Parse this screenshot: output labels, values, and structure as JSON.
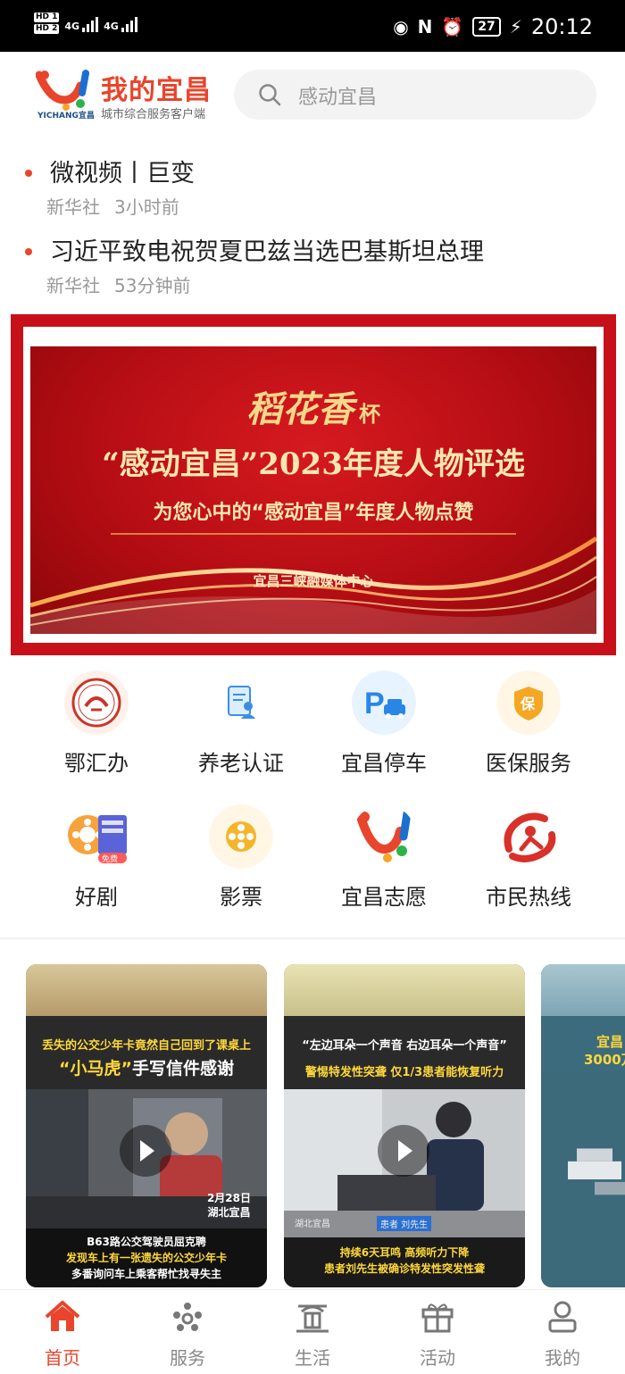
{
  "status_bar": {
    "sim1": "HD 1",
    "sim2": "HD 2",
    "net1": "4G",
    "net2": "4G",
    "battery": "27",
    "time": "20:12"
  },
  "header": {
    "app_title": "我的宜昌",
    "app_subtitle": "城市综合服务客户端",
    "logo_en": "YICHANG宜昌",
    "search_placeholder": "感动宜昌"
  },
  "news": [
    {
      "title": "微视频丨巨变",
      "source": "新华社",
      "time": "3小时前"
    },
    {
      "title": "习近平致电祝贺夏巴兹当选巴基斯坦总理",
      "source": "新华社",
      "time": "53分钟前"
    }
  ],
  "banner": {
    "brand": "稻花香",
    "brand_suffix": "杯",
    "title": "“感动宜昌”2023年度人物评选",
    "subtitle": "为您心中的“感动宜昌”年度人物点赞",
    "org": "宜昌三峡融媒体中心",
    "colors": {
      "frame": "#c8101a",
      "gold": "#fbe7b0"
    }
  },
  "services": [
    {
      "label": "鄂汇办",
      "icon": "ehuiban-seal-icon"
    },
    {
      "label": "养老认证",
      "icon": "document-person-icon"
    },
    {
      "label": "宜昌停车",
      "icon": "parking-icon"
    },
    {
      "label": "医保服务",
      "icon": "medical-insurance-shield-icon"
    },
    {
      "label": "好剧",
      "icon": "film-reel-icon",
      "badge": "免费"
    },
    {
      "label": "影票",
      "icon": "movie-ticket-reel-icon"
    },
    {
      "label": "宜昌志愿",
      "icon": "volunteer-logo-icon"
    },
    {
      "label": "市民热线",
      "icon": "hotline-icon"
    }
  ],
  "videos": [
    {
      "cap1": "丢失的公交少年卡竟然自己回到了课桌上",
      "cap2_hl": "“小马虎”",
      "cap2": "手写信件感谢",
      "date": "2月28日",
      "place": "湖北宜昌",
      "line1": "B63路公交驾驶员屈克聘",
      "line2": "发现车上有一张遗失的公交少年卡",
      "line3": "多番询问车上乘客帮忙找寻失主"
    },
    {
      "cap1": "“左边耳朵一个声音 右边耳朵一个声音”",
      "cap2": "警惕特发性突聋 仅1/3患者能恢复听力",
      "tag_left": "湖北宜昌",
      "tag_right": "患者 刘先生",
      "line1": "持续6天耳鸣 高频听力下降",
      "line2": "患者刘先生被确诊特发性突发性聋"
    },
    {
      "cap1": "宜昌",
      "cap2": "3000万"
    }
  ],
  "tabs": [
    {
      "label": "首页",
      "icon": "home-icon",
      "active": true
    },
    {
      "label": "服务",
      "icon": "service-people-icon"
    },
    {
      "label": "生活",
      "icon": "life-building-icon"
    },
    {
      "label": "活动",
      "icon": "gift-activity-icon"
    },
    {
      "label": "我的",
      "icon": "profile-icon"
    }
  ],
  "accent_color": "#e8452c"
}
